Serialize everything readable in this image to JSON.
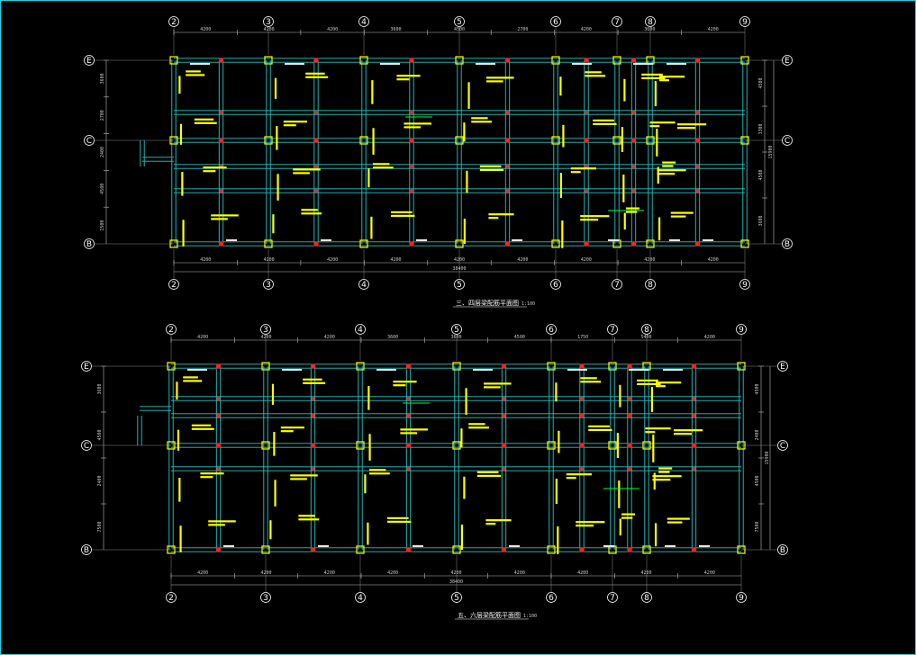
{
  "plans": [
    {
      "title": "三、四层梁配筋平面图",
      "scale": "1:100",
      "total_length": "38400",
      "total_depth": "15900",
      "col_axes": [
        "2",
        "3",
        "4",
        "5",
        "6",
        "7",
        "8",
        "9"
      ],
      "row_axes": [
        "E",
        "C",
        "B"
      ],
      "top_dims": [
        "4200",
        "4200",
        "4200",
        "3600",
        "4500",
        "2700",
        "4200",
        "3600",
        "4200"
      ],
      "bottom_dims": [
        "4200",
        "4200",
        "4200",
        "4200",
        "4200",
        "4200",
        "4200",
        "4200",
        "4200"
      ],
      "left_dims": [
        "3600",
        "2700",
        "2400",
        "4500",
        "1500"
      ],
      "right_dims": [
        "4500",
        "3300",
        "4500",
        "3600"
      ]
    },
    {
      "title": "五、六层梁配筋平面图",
      "scale": "1:100",
      "total_length": "38400",
      "total_depth": "15900",
      "col_axes": [
        "2",
        "3",
        "4",
        "5",
        "6",
        "7",
        "8",
        "9"
      ],
      "row_axes": [
        "E",
        "C",
        "B"
      ],
      "top_dims": [
        "4200",
        "4200",
        "4200",
        "3600",
        "3600",
        "4500",
        "1750",
        "5400",
        "4200"
      ],
      "bottom_dims": [
        "4200",
        "4200",
        "4200",
        "4200",
        "4200",
        "4200",
        "4200",
        "4200",
        "4200"
      ],
      "left_dims": [
        "3600",
        "4500",
        "2400",
        "7500"
      ],
      "right_dims": [
        "4500",
        "2400",
        "4500",
        "7500"
      ]
    }
  ],
  "colors": {
    "frame": "#19d3e6",
    "beam": "#26c6c6",
    "column": "#ffff00",
    "red_column": "#ff2020",
    "annotation": "#ffff00",
    "dimension": "#c8c8c8",
    "green": "#00ff40"
  }
}
